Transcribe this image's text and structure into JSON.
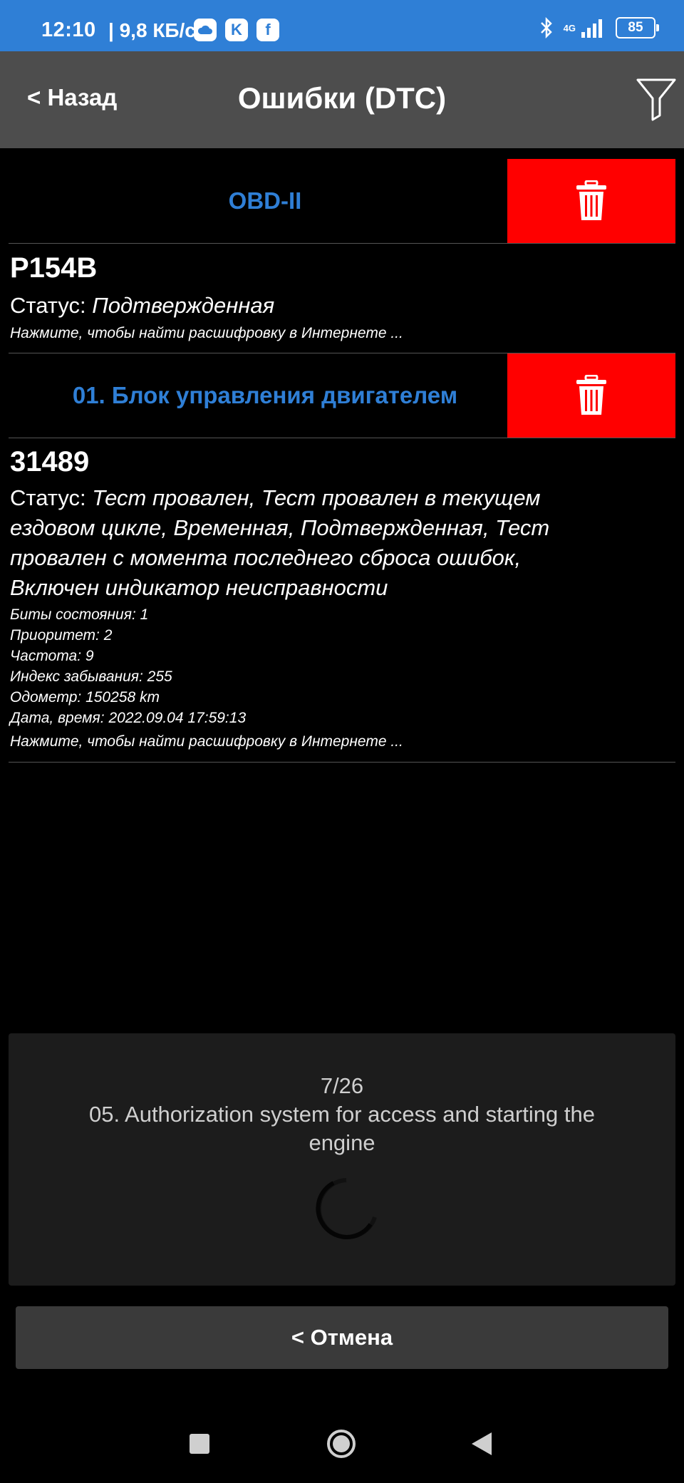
{
  "status_bar": {
    "time": "12:10",
    "speed": "| 9,8 КБ/с",
    "app_icons": [
      "cloud-app-icon",
      "k-app-icon",
      "facebook-icon"
    ],
    "network": "4G",
    "battery": "85"
  },
  "header": {
    "back_label": "< Назад",
    "title": "Ошибки (DTC)",
    "filter_icon": "filter-icon"
  },
  "sections": [
    {
      "title": "OBD-II",
      "delete_icon": "trash-icon",
      "dtc": {
        "code": "P154B",
        "status_label": "Статус:",
        "status_value": "Подтвержденная",
        "link_hint": "Нажмите, чтобы найти расшифровку в Интернете ..."
      }
    },
    {
      "title": "01. Блок управления двигателем",
      "delete_icon": "trash-icon",
      "dtc": {
        "code": "31489",
        "status_label": "Статус:",
        "status_value_lines": [
          "Тест провален, Тест провален в текущем",
          "ездовом цикле, Временная, Подтвержденная, Тест",
          "провален с момента последнего сброса ошибок,",
          "Включен индикатор неисправности"
        ],
        "details": [
          "Биты состояния: 1",
          "Приоритет: 2",
          "Частота: 9",
          "Индекс забывания: 255",
          "Одометр: 150258 km",
          "Дата, время: 2022.09.04 17:59:13"
        ],
        "link_hint": "Нажмите, чтобы найти расшифровку в Интернете ..."
      }
    }
  ],
  "progress": {
    "count": "7/26",
    "text_lines": [
      "05. Authorization system for access and starting the",
      "engine"
    ]
  },
  "cancel_label": "< Отмена",
  "colors": {
    "status_bar": "#2f7fd6",
    "header": "#4d4d4d",
    "section_title": "#2f7fd6",
    "delete": "#ff0000",
    "background": "#000000"
  }
}
